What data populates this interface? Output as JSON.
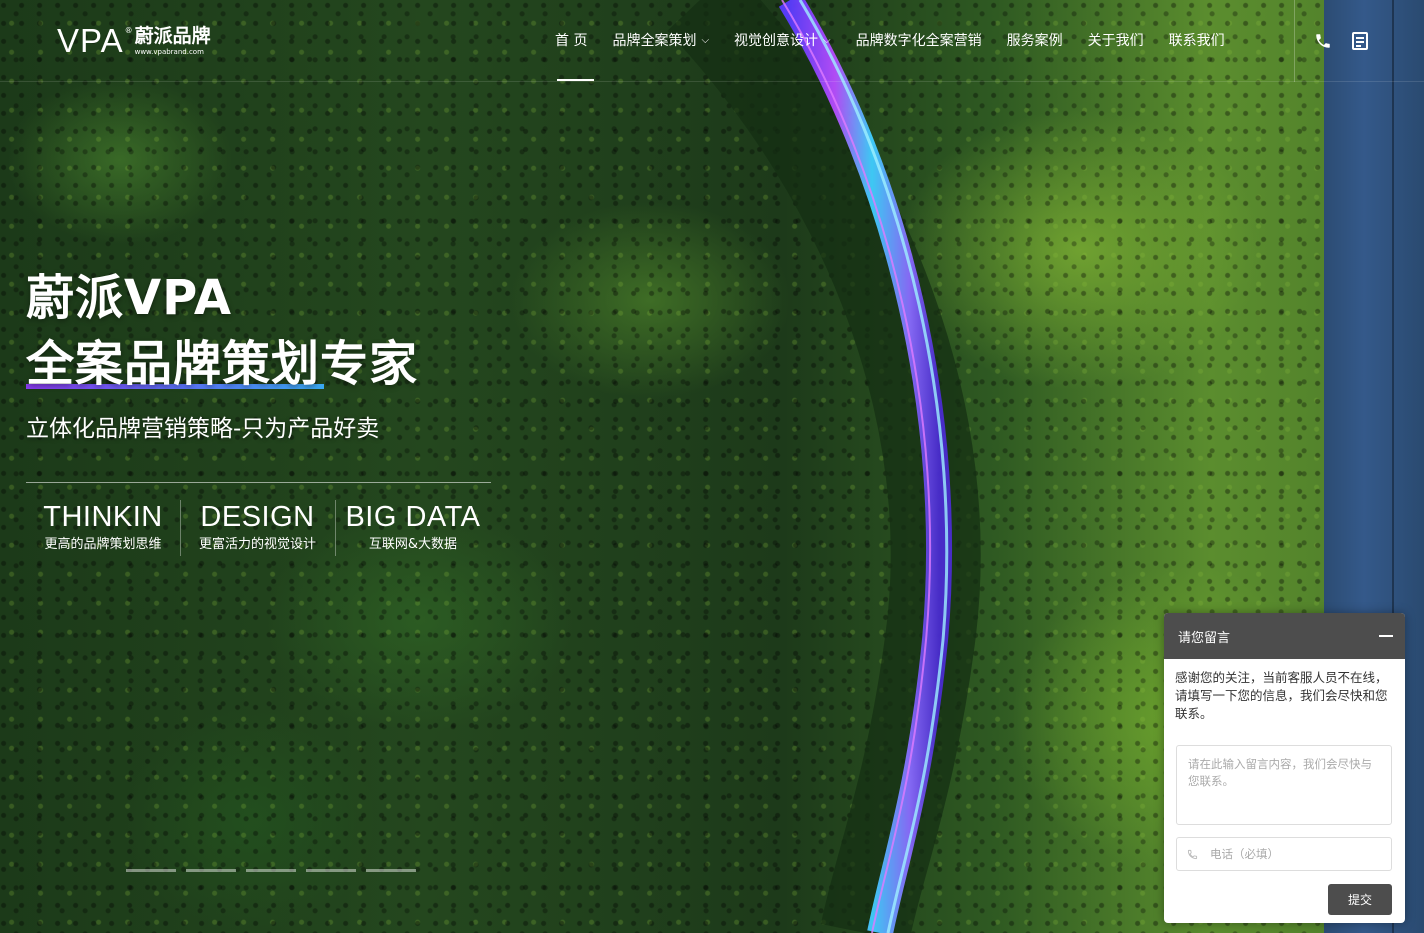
{
  "logo": {
    "mark": "VPA",
    "reg": "®",
    "name_cn": "蔚派品牌",
    "url": "www.vpabrand.com"
  },
  "nav": {
    "items": [
      {
        "label": "首 页",
        "dropdown": false,
        "active": true
      },
      {
        "label": "品牌全案策划",
        "dropdown": true
      },
      {
        "label": "视觉创意设计",
        "dropdown": true
      },
      {
        "label": "品牌数字化全案营销",
        "dropdown": false
      },
      {
        "label": "服务案例",
        "dropdown": false
      },
      {
        "label": "关于我们",
        "dropdown": false
      },
      {
        "label": "联系我们",
        "dropdown": false
      }
    ],
    "caret": "⌵",
    "icons": [
      "phone-icon",
      "document-icon"
    ]
  },
  "hero": {
    "title_line1": "蔚派VPA",
    "title_line2": "全案品牌策划专家",
    "subtitle": "立体化品牌营销策略-只为产品好卖",
    "features": [
      {
        "title": "THINKIN",
        "desc": "更高的品牌策划思维"
      },
      {
        "title": "DESIGN",
        "desc": "更富活力的视觉设计"
      },
      {
        "title": "BIG DATA",
        "desc": "互联网&大数据"
      }
    ],
    "slides_count": 5
  },
  "message_widget": {
    "title": "请您留言",
    "notice": "感谢您的关注，当前客服人员不在线，请填写一下您的信息，我们会尽快和您联系。",
    "message_placeholder": "请在此输入留言内容，我们会尽快与您联系。",
    "phone_placeholder": "电话（必填）",
    "submit_label": "提交"
  },
  "colors": {
    "accent_gradient_start": "#8a3cf0",
    "accent_gradient_end": "#3aa8f0",
    "widget_header": "#4d4d4d"
  }
}
